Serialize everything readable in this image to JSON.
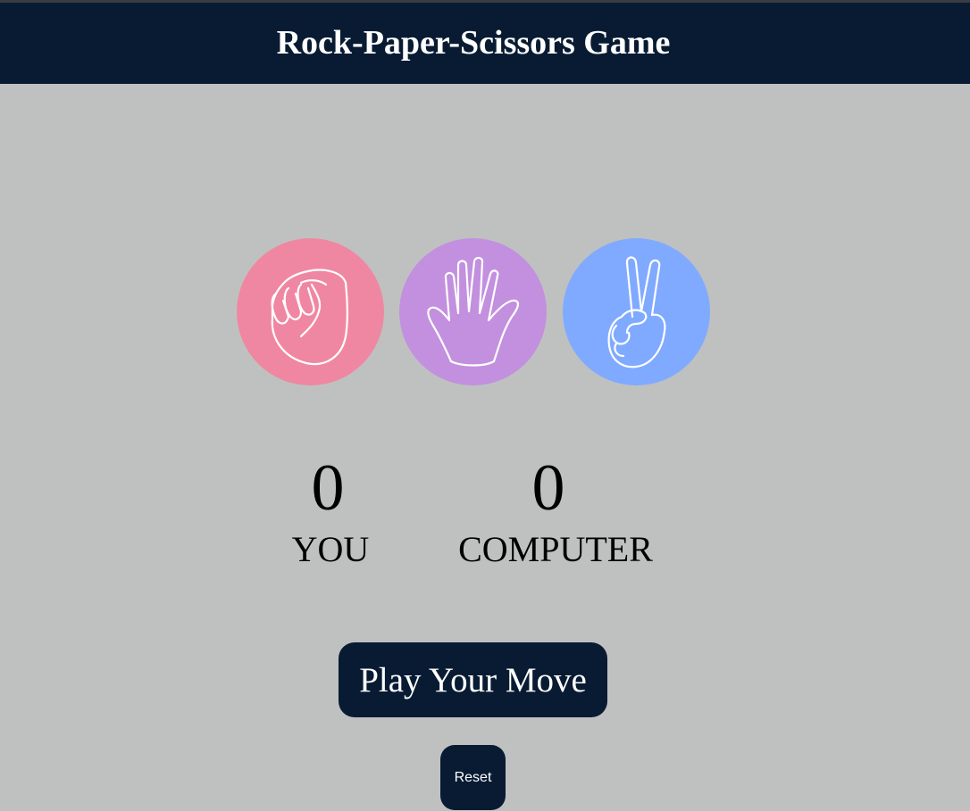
{
  "header": {
    "title": "Rock-Paper-Scissors Game"
  },
  "choices": [
    {
      "id": "rock",
      "icon": "rock-fist-icon",
      "color": "#f087a2"
    },
    {
      "id": "paper",
      "icon": "paper-hand-icon",
      "color": "#c290de"
    },
    {
      "id": "scissors",
      "icon": "scissors-hand-icon",
      "color": "#80aaff"
    }
  ],
  "scoreboard": {
    "user": {
      "score": "0",
      "label": "YOU"
    },
    "computer": {
      "score": "0",
      "label": "COMPUTER"
    }
  },
  "message": {
    "text": "Play Your Move"
  },
  "controls": {
    "reset_label": "Reset"
  },
  "colors": {
    "background": "#bfc1c0",
    "header": "#081b33",
    "button": "#081b33"
  }
}
